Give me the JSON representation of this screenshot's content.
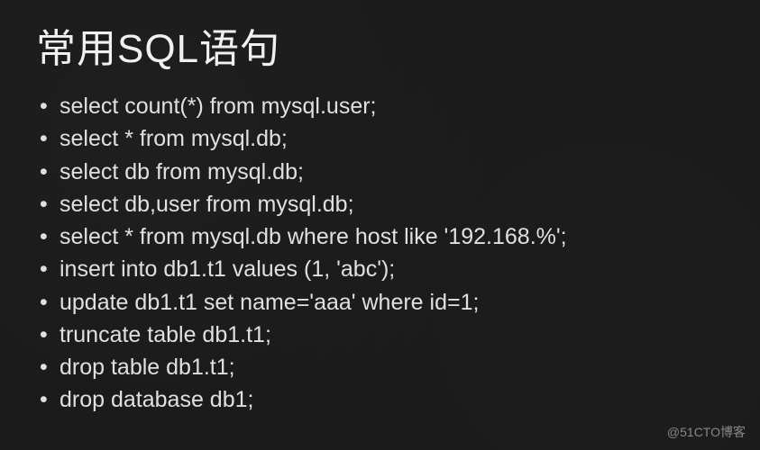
{
  "slide": {
    "title": "常用SQL语句",
    "items": [
      "select count(*) from mysql.user;",
      "select * from mysql.db;",
      "select db from mysql.db;",
      "select db,user from mysql.db;",
      "select * from mysql.db where host like '192.168.%';",
      "insert into db1.t1 values (1, 'abc');",
      "update db1.t1 set name='aaa' where id=1;",
      "truncate table db1.t1;",
      "drop table db1.t1;",
      "drop database db1;"
    ]
  },
  "watermark": "@51CTO博客"
}
